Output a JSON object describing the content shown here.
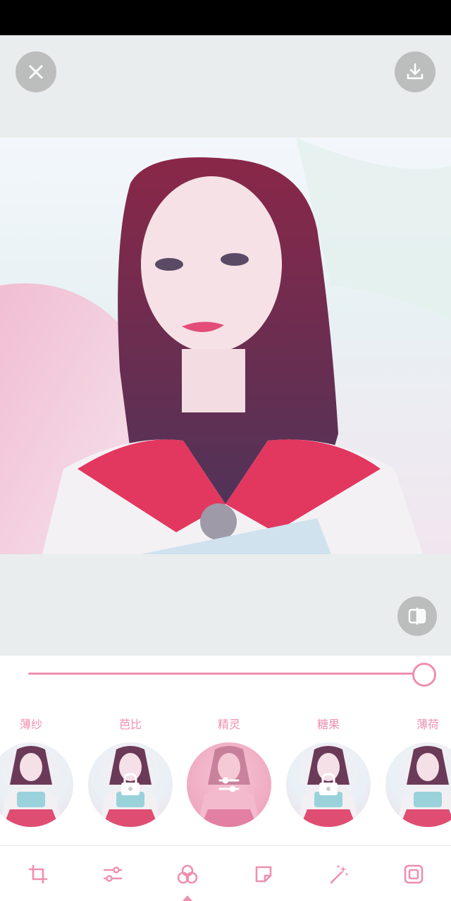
{
  "toolbar": {
    "close_icon": "close-icon",
    "download_icon": "download-icon",
    "compare_icon": "compare-icon"
  },
  "editor": {
    "intensity": 1.0,
    "accent": "#ef8fb0"
  },
  "filters": [
    {
      "label": "薄纱",
      "locked": false,
      "selected": false
    },
    {
      "label": "芭比",
      "locked": true,
      "selected": false
    },
    {
      "label": "精灵",
      "locked": false,
      "selected": true
    },
    {
      "label": "糖果",
      "locked": true,
      "selected": false
    },
    {
      "label": "薄荷",
      "locked": false,
      "selected": false
    }
  ],
  "bottom_tools": [
    {
      "name": "crop-icon"
    },
    {
      "name": "adjust-icon"
    },
    {
      "name": "filter-icon",
      "active": true
    },
    {
      "name": "sticker-icon"
    },
    {
      "name": "magic-wand-icon"
    },
    {
      "name": "frame-icon"
    }
  ]
}
